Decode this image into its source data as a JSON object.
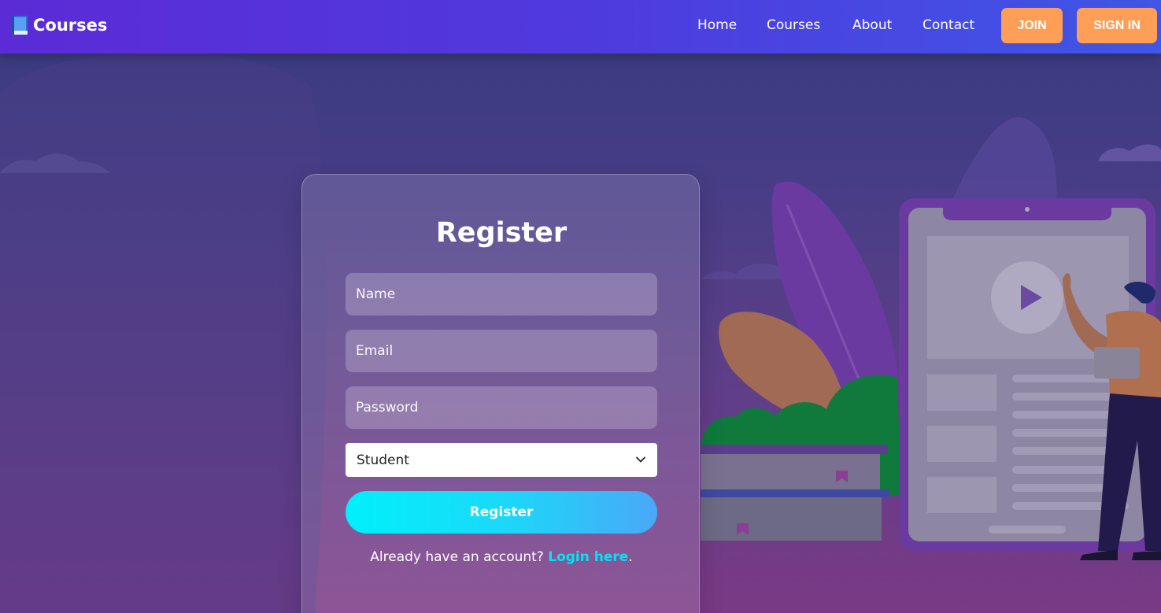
{
  "navbar": {
    "brand": "Courses",
    "links": [
      "Home",
      "Courses",
      "About",
      "Contact"
    ],
    "join_label": "JOIN",
    "signin_label": "SIGN IN"
  },
  "form": {
    "title": "Register",
    "name_placeholder": "Name",
    "email_placeholder": "Email",
    "password_placeholder": "Password",
    "role_selected": "Student",
    "submit_label": "Register",
    "login_prompt": "Already have an account?",
    "login_link": "Login here",
    "login_suffix": "."
  },
  "colors": {
    "nav_start": "#5b2bd6",
    "nav_end": "#3f56e6",
    "button_orange": "#ff9f57",
    "register_start": "#00f0fa",
    "register_end": "#4aa8f7",
    "login_link": "#00e5f5"
  }
}
